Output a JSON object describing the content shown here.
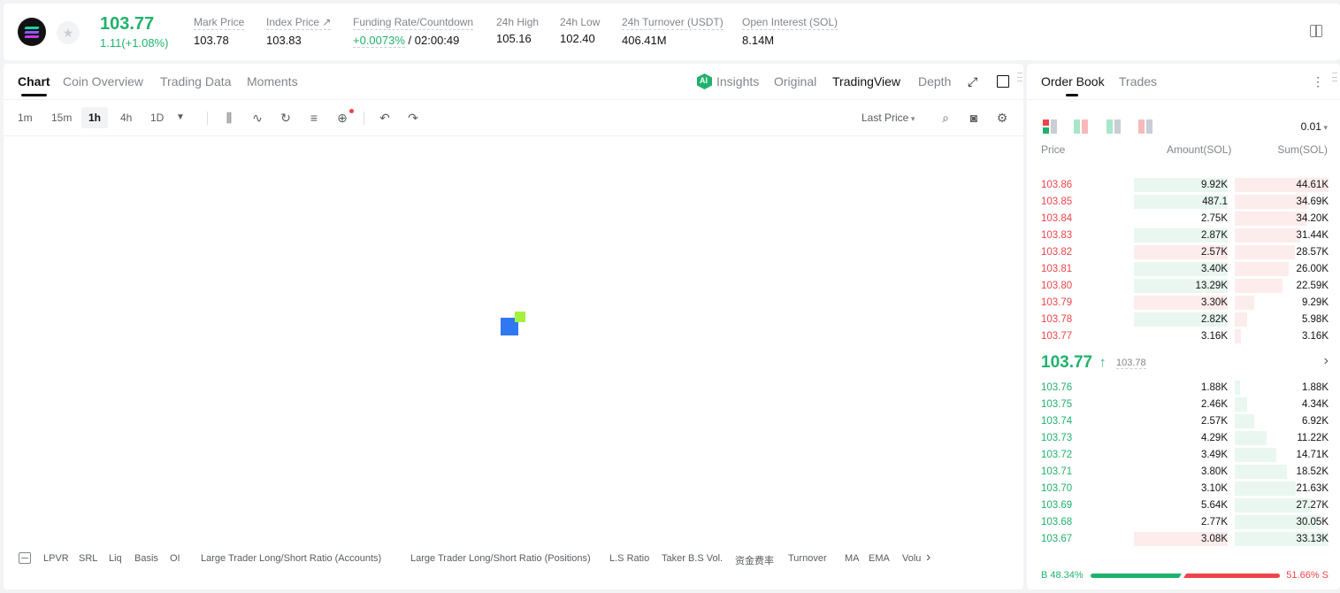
{
  "ticker": {
    "last_price": "103.77",
    "change": "1.11(+1.08%)",
    "stats": [
      {
        "label": "Mark Price",
        "value": "103.78"
      },
      {
        "label": "Index Price ↗",
        "value": "103.83"
      },
      {
        "label": "Funding Rate/Countdown",
        "value_green": "+0.0073%",
        "value": "/ 02:00:49"
      },
      {
        "label": "24h High",
        "value": "105.16"
      },
      {
        "label": "24h Low",
        "value": "102.40"
      },
      {
        "label": "24h Turnover (USDT)",
        "value": "406.41M"
      },
      {
        "label": "Open Interest (SOL)",
        "value": "8.14M"
      }
    ]
  },
  "chart": {
    "tabs": [
      "Chart",
      "Coin Overview",
      "Trading Data",
      "Moments"
    ],
    "right_tabs": [
      "Insights",
      "Original",
      "TradingView",
      "Depth"
    ],
    "timeframes": [
      "1m",
      "15m",
      "1h",
      "4h",
      "1D"
    ],
    "active_timeframe": "1h",
    "price_source": "Last Price",
    "indicators": [
      "LPVR",
      "SRL",
      "Liq",
      "Basis",
      "OI",
      "Large Trader Long/Short Ratio (Accounts)",
      "Large Trader Long/Short Ratio (Positions)",
      "L.S Ratio",
      "Taker B.S Vol.",
      "资金费率",
      "Turnover",
      "MA",
      "EMA",
      "Volu"
    ]
  },
  "orderbook": {
    "tabs": [
      "Order Book",
      "Trades"
    ],
    "tick": "0.01",
    "headers": {
      "price": "Price",
      "amount": "Amount(SOL)",
      "sum": "Sum(SOL)"
    },
    "asks": [
      {
        "price": "103.86",
        "amount": "9.92K",
        "sum": "44.61K",
        "amt_frac": 0.75,
        "sum_frac": 1.0,
        "amt_color": "green"
      },
      {
        "price": "103.85",
        "amount": "487.1",
        "sum": "34.69K",
        "amt_frac": 0.75,
        "sum_frac": 0.78,
        "amt_color": "green"
      },
      {
        "price": "103.84",
        "amount": "2.75K",
        "sum": "34.20K",
        "amt_frac": 0.75,
        "sum_frac": 0.77,
        "amt_color": "none"
      },
      {
        "price": "103.83",
        "amount": "2.87K",
        "sum": "31.44K",
        "amt_frac": 0.75,
        "sum_frac": 0.7,
        "amt_color": "green"
      },
      {
        "price": "103.82",
        "amount": "2.57K",
        "sum": "28.57K",
        "amt_frac": 0.75,
        "sum_frac": 0.64,
        "amt_color": "red"
      },
      {
        "price": "103.81",
        "amount": "3.40K",
        "sum": "26.00K",
        "amt_frac": 0.75,
        "sum_frac": 0.58,
        "amt_color": "green"
      },
      {
        "price": "103.80",
        "amount": "13.29K",
        "sum": "22.59K",
        "amt_frac": 0.75,
        "sum_frac": 0.51,
        "amt_color": "green"
      },
      {
        "price": "103.79",
        "amount": "3.30K",
        "sum": "9.29K",
        "amt_frac": 0.75,
        "sum_frac": 0.21,
        "amt_color": "red"
      },
      {
        "price": "103.78",
        "amount": "2.82K",
        "sum": "5.98K",
        "amt_frac": 0.75,
        "sum_frac": 0.13,
        "amt_color": "green"
      },
      {
        "price": "103.77",
        "amount": "3.16K",
        "sum": "3.16K",
        "amt_frac": 0.75,
        "sum_frac": 0.07,
        "amt_color": "none"
      }
    ],
    "mid": {
      "price": "103.77",
      "arrow": "↑",
      "mark": "103.78",
      "more": "›"
    },
    "bids": [
      {
        "price": "103.76",
        "amount": "1.88K",
        "sum": "1.88K",
        "amt_frac": 0.75,
        "sum_frac": 0.06,
        "amt_color": "none"
      },
      {
        "price": "103.75",
        "amount": "2.46K",
        "sum": "4.34K",
        "amt_frac": 0.75,
        "sum_frac": 0.13,
        "amt_color": "none"
      },
      {
        "price": "103.74",
        "amount": "2.57K",
        "sum": "6.92K",
        "amt_frac": 0.75,
        "sum_frac": 0.21,
        "amt_color": "none"
      },
      {
        "price": "103.73",
        "amount": "4.29K",
        "sum": "11.22K",
        "amt_frac": 0.75,
        "sum_frac": 0.34,
        "amt_color": "none"
      },
      {
        "price": "103.72",
        "amount": "3.49K",
        "sum": "14.71K",
        "amt_frac": 0.75,
        "sum_frac": 0.44,
        "amt_color": "none"
      },
      {
        "price": "103.71",
        "amount": "3.80K",
        "sum": "18.52K",
        "amt_frac": 0.75,
        "sum_frac": 0.56,
        "amt_color": "none"
      },
      {
        "price": "103.70",
        "amount": "3.10K",
        "sum": "21.63K",
        "amt_frac": 0.75,
        "sum_frac": 0.65,
        "amt_color": "none"
      },
      {
        "price": "103.69",
        "amount": "5.64K",
        "sum": "27.27K",
        "amt_frac": 0.75,
        "sum_frac": 0.82,
        "amt_color": "none"
      },
      {
        "price": "103.68",
        "amount": "2.77K",
        "sum": "30.05K",
        "amt_frac": 0.75,
        "sum_frac": 0.91,
        "amt_color": "none"
      },
      {
        "price": "103.67",
        "amount": "3.08K",
        "sum": "33.13K",
        "amt_frac": 0.75,
        "sum_frac": 1.0,
        "amt_color": "red"
      }
    ],
    "ratio": {
      "buy_label": "B 48.34%",
      "sell_label": "51.66% S",
      "buy_pct": 48.34
    }
  },
  "colors": {
    "green": "#20b26c",
    "red": "#ef454a",
    "green_bg": "#e9f7f0",
    "red_bg": "#fdecec"
  }
}
